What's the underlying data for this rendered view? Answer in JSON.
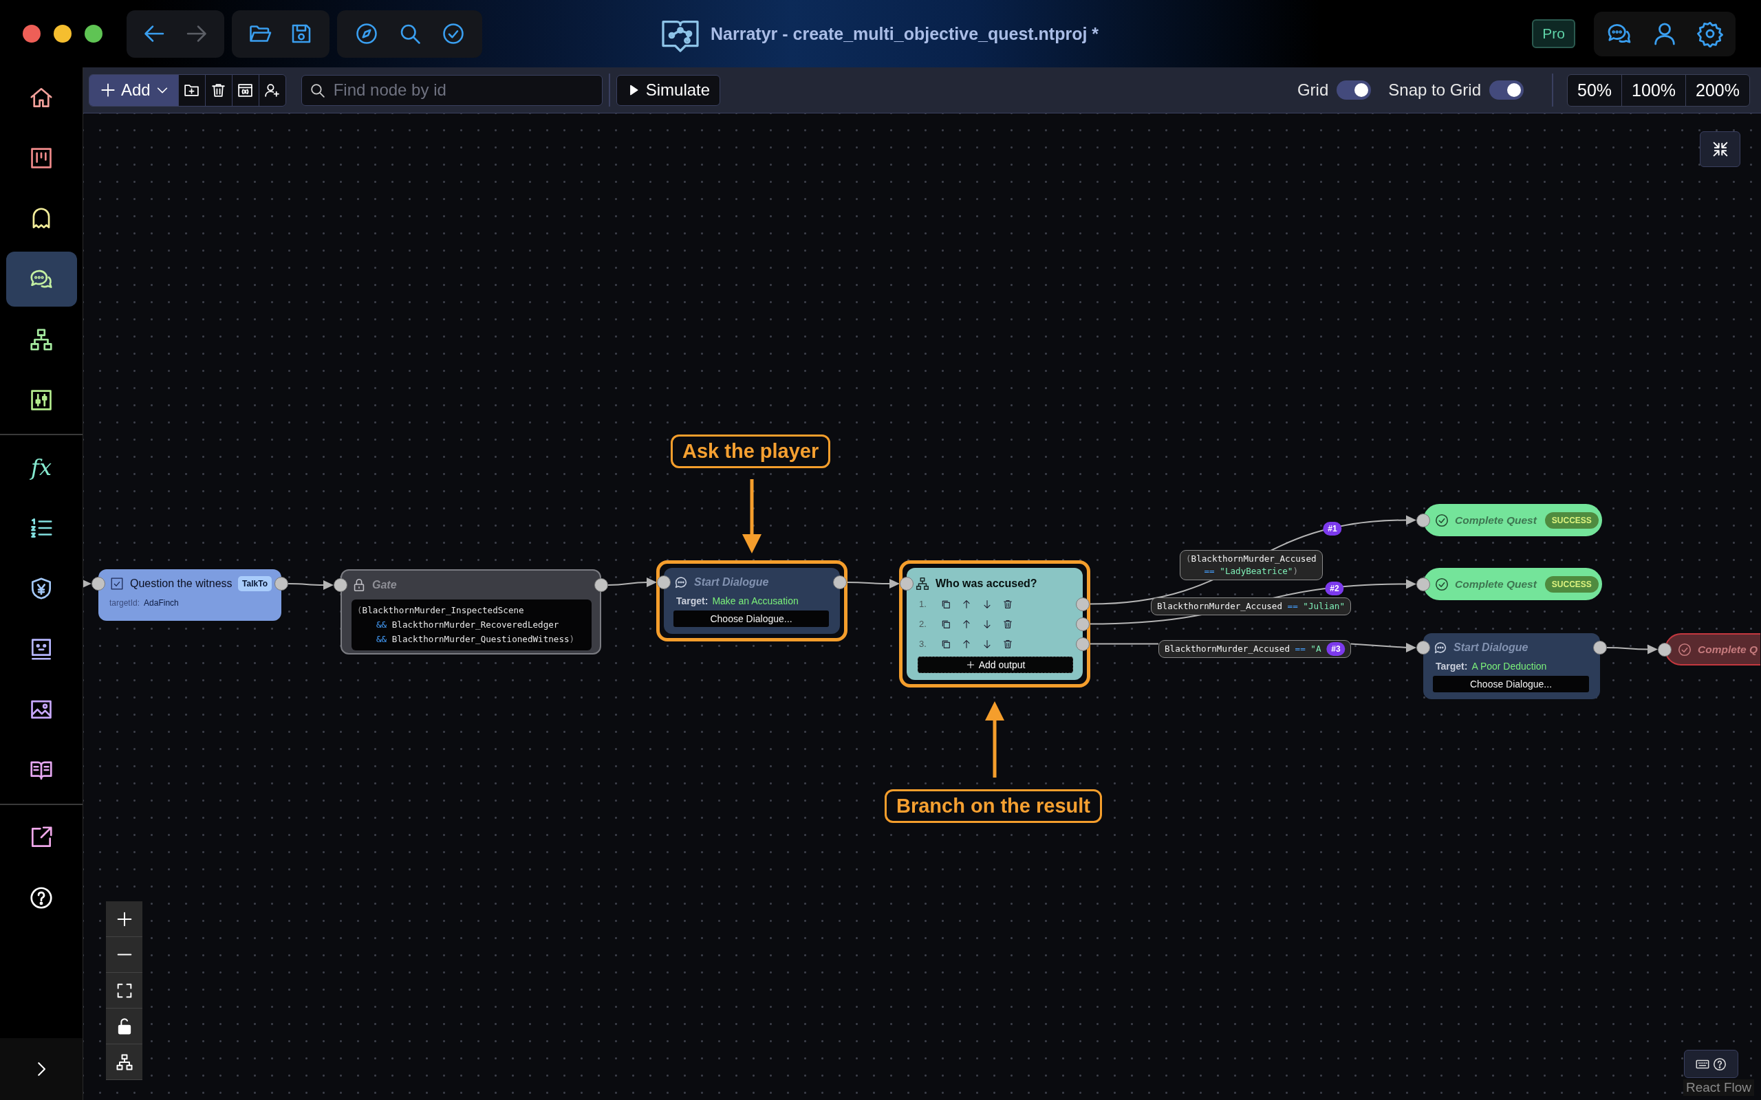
{
  "titlebar": {
    "navigation": [
      {
        "kind": "back",
        "disabled": false
      },
      {
        "kind": "forward",
        "disabled": true
      }
    ],
    "title": "Narratyr - create_multi_objective_quest.ntproj *",
    "badge": "Pro"
  },
  "sidebar": {
    "groups": [
      {
        "items": [
          {
            "kind": "home",
            "selected": false
          },
          {
            "kind": "board",
            "selected": false
          },
          {
            "kind": "characters",
            "selected": false
          },
          {
            "kind": "dialogue",
            "selected": true
          },
          {
            "kind": "quests",
            "selected": false
          },
          {
            "kind": "mixer",
            "selected": false
          }
        ]
      },
      {
        "items": [
          {
            "kind": "functions",
            "glyph": "fx",
            "selected": false
          },
          {
            "kind": "list",
            "selected": false
          },
          {
            "kind": "currency",
            "selected": false
          },
          {
            "kind": "card",
            "selected": false
          },
          {
            "kind": "images",
            "selected": false
          },
          {
            "kind": "book",
            "selected": false
          }
        ]
      },
      {
        "items": [
          {
            "kind": "export",
            "selected": false
          },
          {
            "kind": "help",
            "selected": false
          }
        ]
      }
    ]
  },
  "toolbar": {
    "add_button": "Add",
    "search": {
      "placeholder": "Find node by id"
    },
    "simulate_button": "Simulate",
    "toggles": [
      {
        "label": "Grid",
        "on": true
      },
      {
        "label": "Snap to Grid",
        "on": true
      }
    ],
    "zoom_levels": [
      "50%",
      "100%",
      "200%"
    ]
  },
  "canvas": {
    "nodes": [
      {
        "kind": "objective",
        "checked": true,
        "title": "Question the witness",
        "tag": "TalkTo",
        "field_label": "targetId:",
        "field_value": "AdaFinch",
        "highlighted": false
      },
      {
        "kind": "gate",
        "title": "Gate",
        "condition": [
          [
            {
              "kind": "paren",
              "text": "("
            },
            {
              "kind": "ident",
              "text": "BlackthornMurder_InspectedScene"
            }
          ],
          [
            {
              "kind": "op",
              "text": "&&"
            },
            {
              "kind": "ident",
              "text": "BlackthornMurder_RecoveredLedger"
            }
          ],
          [
            {
              "kind": "op",
              "text": "&&"
            },
            {
              "kind": "ident",
              "text": "BlackthornMurder_QuestionedWitness"
            },
            {
              "kind": "paren",
              "text": ")"
            }
          ]
        ],
        "highlighted": false
      },
      {
        "kind": "start_dialogue",
        "title": "Start Dialogue",
        "target_label": "Target:",
        "target": "Make an Accusation",
        "button": "Choose Dialogue...",
        "highlighted": true
      },
      {
        "kind": "branch",
        "title": "Who was accused?",
        "outputs": [
          "1.",
          "2.",
          "3."
        ],
        "add_button": "Add output",
        "highlighted": true
      },
      {
        "kind": "complete_quest",
        "title": "Complete Quest",
        "failed": false,
        "result": "SUCCESS",
        "highlighted": false
      },
      {
        "kind": "complete_quest",
        "title": "Complete Quest",
        "failed": false,
        "result": "SUCCESS",
        "highlighted": false
      },
      {
        "kind": "start_dialogue",
        "title": "Start Dialogue",
        "target_label": "Target:",
        "target": "A Poor Deduction",
        "button": "Choose Dialogue...",
        "highlighted": false
      },
      {
        "kind": "complete_quest",
        "title": "Complete Q",
        "failed": true,
        "highlighted": false
      }
    ],
    "branch_edges": [
      {
        "condition": [
          [
            {
              "kind": "paren",
              "text": "("
            },
            {
              "kind": "ident",
              "text": "BlackthornMurder_Accused"
            }
          ],
          [
            {
              "kind": "op",
              "text": "=="
            },
            {
              "kind": "string",
              "text": "\"LadyBeatrice\""
            },
            {
              "kind": "paren",
              "text": ")"
            }
          ]
        ],
        "badge": "#1"
      },
      {
        "condition": [
          [
            {
              "kind": "ident",
              "text": "BlackthornMurder_Accused"
            },
            {
              "kind": "op",
              "text": "=="
            },
            {
              "kind": "string",
              "text": "\"Julian\""
            }
          ]
        ],
        "badge": "#2"
      },
      {
        "condition": [
          [
            {
              "kind": "ident",
              "text": "BlackthornMurder_Accused"
            },
            {
              "kind": "op",
              "text": "=="
            },
            {
              "kind": "string",
              "text": "\"A"
            }
          ]
        ],
        "badge": "#3"
      }
    ],
    "callouts": [
      {
        "text": "Ask the player",
        "points_down": true
      },
      {
        "text": "Branch on the result",
        "points_down": false
      }
    ],
    "attribution": "React Flow"
  }
}
